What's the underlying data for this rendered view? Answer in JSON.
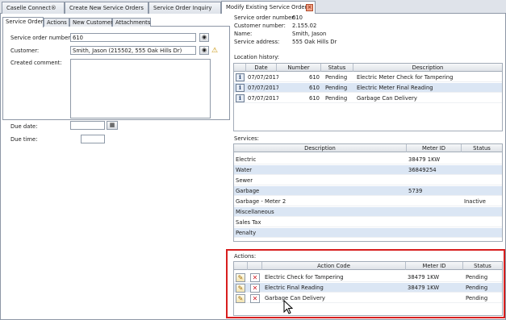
{
  "top_tabs": [
    {
      "label": "Caselle Connect®"
    },
    {
      "label": "Create New Service Orders"
    },
    {
      "label": "Service Order Inquiry"
    },
    {
      "label": "Modify Existing Service Orders"
    }
  ],
  "sub_tabs": [
    {
      "label": "Service Order"
    },
    {
      "label": "Actions"
    },
    {
      "label": "New Customer"
    },
    {
      "label": "Attachments"
    }
  ],
  "form": {
    "order_number_label": "Service order number:",
    "order_number_value": "610",
    "customer_label": "Customer:",
    "customer_value": "Smith, Jason (215502, 555 Oak Hills Dr)",
    "comment_label": "Created comment:",
    "due_date_label": "Due date:",
    "due_time_label": "Due time:"
  },
  "info": {
    "order_number_label": "Service order number:",
    "order_number_value": "610",
    "customer_number_label": "Customer number:",
    "customer_number_value": "2.155.02",
    "name_label": "Name:",
    "name_value": "Smith, Jason",
    "address_label": "Service address:",
    "address_value": "555 Oak Hills Dr"
  },
  "location_history": {
    "title": "Location history:",
    "columns": [
      "Date",
      "Number",
      "Status",
      "Description"
    ],
    "rows": [
      {
        "date": "07/07/2017",
        "number": "610",
        "status": "Pending",
        "description": "Electric Meter Check for Tampering"
      },
      {
        "date": "07/07/2017",
        "number": "610",
        "status": "Pending",
        "description": "Electric Meter Final Reading"
      },
      {
        "date": "07/07/2017",
        "number": "610",
        "status": "Pending",
        "description": "Garbage Can Delivery"
      }
    ]
  },
  "services": {
    "title": "Services:",
    "columns": [
      "Description",
      "Meter ID",
      "Status"
    ],
    "rows": [
      {
        "description": "Electric",
        "meter_id": "38479 1KW",
        "status": ""
      },
      {
        "description": "Water",
        "meter_id": "36849254",
        "status": ""
      },
      {
        "description": "Sewer",
        "meter_id": "",
        "status": ""
      },
      {
        "description": "Garbage",
        "meter_id": "5739",
        "status": ""
      },
      {
        "description": "Garbage - Meter 2",
        "meter_id": "",
        "status": "Inactive"
      },
      {
        "description": "Miscellaneous",
        "meter_id": "",
        "status": ""
      },
      {
        "description": "Sales Tax",
        "meter_id": "",
        "status": ""
      },
      {
        "description": "Penalty",
        "meter_id": "",
        "status": ""
      }
    ]
  },
  "actions": {
    "title": "Actions:",
    "columns": [
      "Action Code",
      "Meter ID",
      "Status"
    ],
    "rows": [
      {
        "action_code": "Electric Check for Tampering",
        "meter_id": "38479 1KW",
        "status": "Pending"
      },
      {
        "action_code": "Electric Final Reading",
        "meter_id": "38479 1KW",
        "status": "Pending"
      },
      {
        "action_code": "Garbage Can Delivery",
        "meter_id": "",
        "status": "Pending"
      }
    ]
  },
  "icons": {
    "close": "close-icon",
    "binoculars": "binoculars-icon",
    "warning": "warning-icon",
    "calendar": "calendar-icon",
    "info": "info-icon",
    "edit": "pencil-icon",
    "delete": "delete-x-icon",
    "cursor": "mouse-pointer-icon"
  },
  "colors": {
    "highlight_box": "#d81e1e",
    "alt_row": "#dbe6f4"
  }
}
